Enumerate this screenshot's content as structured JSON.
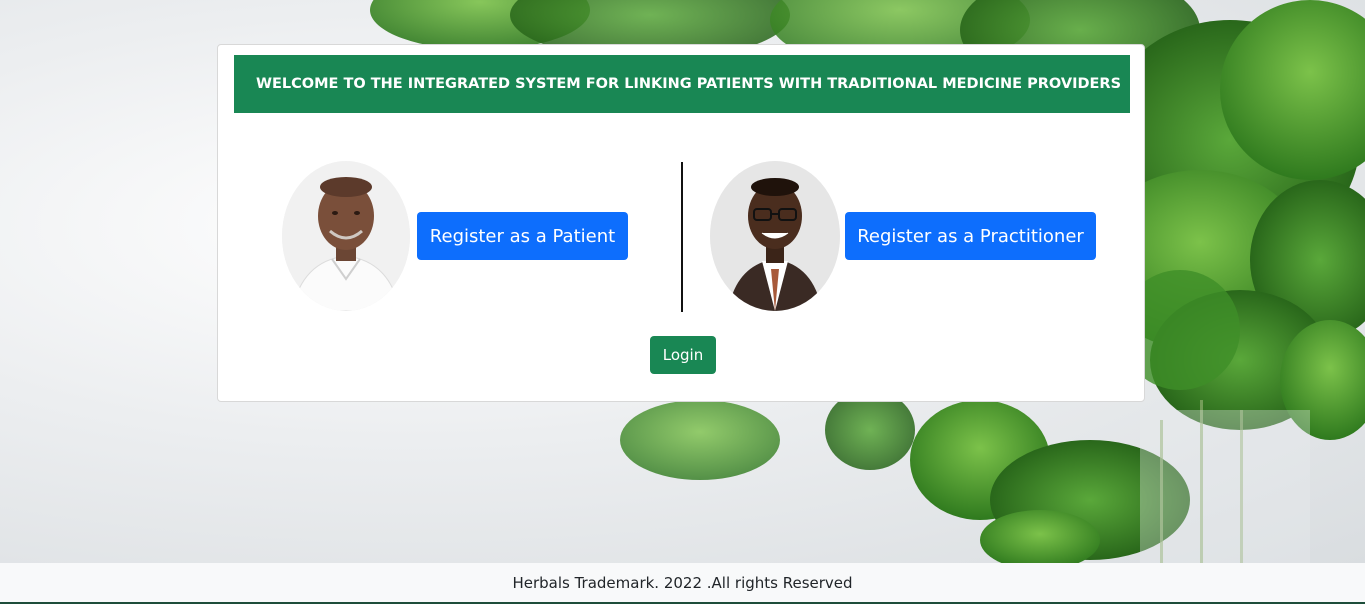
{
  "banner": {
    "title": "WELCOME TO THE INTEGRATED SYSTEM FOR LINKING PATIENTS WITH TRADITIONAL MEDICINE PROVIDERS"
  },
  "patient": {
    "button_label": "Register as a Patient",
    "avatar": "patient-avatar-photo"
  },
  "practitioner": {
    "button_label": "Register as a Practitioner",
    "avatar": "practitioner-avatar-photo"
  },
  "login": {
    "label": "Login"
  },
  "footer": {
    "text": "Herbals Trademark. 2022 .All rights Reserved"
  },
  "colors": {
    "banner": "#198754",
    "primary_button": "#0d6efd",
    "login_button": "#198754",
    "footer_bg": "#f8f9fa"
  }
}
